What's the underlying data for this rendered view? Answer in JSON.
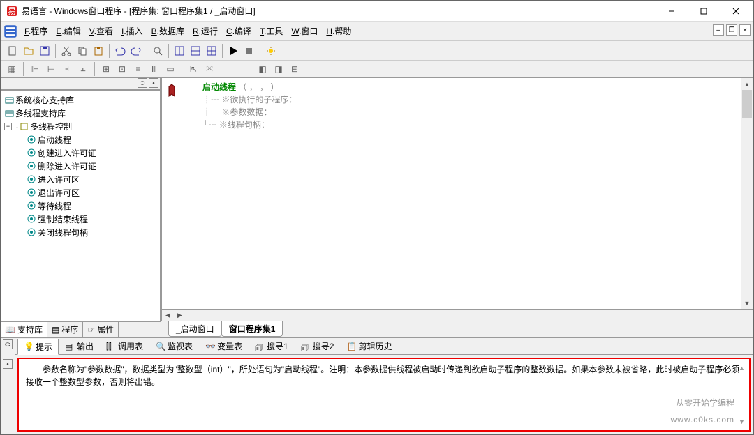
{
  "title": "易语言 - Windows窗口程序 - [程序集: 窗口程序集1 / _启动窗口]",
  "menu": {
    "items": [
      "F.程序",
      "E.编辑",
      "V.查看",
      "I.插入",
      "B.数据库",
      "R.运行",
      "C.编译",
      "T.工具",
      "W.窗口",
      "H.帮助"
    ]
  },
  "tree": {
    "roots": [
      "系统核心支持库",
      "多线程支持库"
    ],
    "group": "多线程控制",
    "leaves": [
      "启动线程",
      "创建进入许可证",
      "删除进入许可证",
      "进入许可区",
      "退出许可区",
      "等待线程",
      "强制结束线程",
      "关闭线程句柄"
    ]
  },
  "lefttabs": {
    "lib": "支持库",
    "prog": "程序",
    "prop": "属性"
  },
  "code": {
    "call": "启动线程",
    "paren": "（ ， ， ）",
    "l1": "※欲执行的子程序：",
    "l2": "※参数数据：",
    "l3": "※线程句柄："
  },
  "edittabs": {
    "win": "_启动窗口",
    "set": "窗口程序集1"
  },
  "btabs": {
    "hint": "提示",
    "out": "输出",
    "call": "调用表",
    "watch": "监视表",
    "var": "变量表",
    "s1": "搜寻1",
    "s2": "搜寻2",
    "clip": "剪辑历史"
  },
  "hint": "　　参数名称为\"参数数据\"，数据类型为\"整数型（int）\"，所处语句为\"启动线程\"。注明：本参数提供线程被启动时传递到欲启动子程序的整数数据。如果本参数未被省略，此时被启动子程序必须接收一个整数型参数，否则将出错。",
  "watermark": {
    "l1": "从零开始学编程",
    "l2": "www.c0ks.com"
  }
}
